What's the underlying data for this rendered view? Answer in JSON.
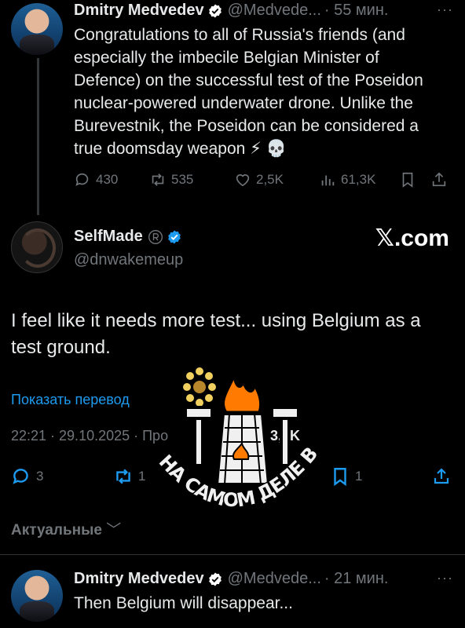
{
  "tweet1": {
    "author": "Dmitry Medvedev",
    "handle": "@Medvede...",
    "time": "· 55 мин.",
    "more": "···",
    "lines": [
      "Congratulations to all of Russia's friends (and",
      "especially the imbecile Belgian Minister of",
      "Defence) on the successful test of the Poseidon",
      "nuclear-powered underwater drone. Unlike the",
      "Burevestnik, the Poseidon can be considered a",
      "true doomsday weapon ⚡ 💀"
    ],
    "replies": "430",
    "reposts": "535",
    "likes": "2,5K",
    "views": "61,3K"
  },
  "tweet2": {
    "author": "SelfMade",
    "handle": "@dnwakemeup",
    "site": "𝕏.com",
    "lines": [
      "I feel like it needs more test... using Belgium as a",
      "test ground."
    ],
    "translate": "Показать перевод",
    "datetime": "22:21 · 29.10.2025 · Про",
    "views": "3,4K",
    "replies": "3",
    "reposts": "1",
    "bookmarks": "1",
    "sort_label": "Актуальные"
  },
  "tweet3": {
    "author": "Dmitry Medvedev",
    "handle": "@Medvede...",
    "time": "· 21 мин.",
    "more": "···",
    "text": "Then Belgium will disappear..."
  },
  "emblem": {
    "slogan": "НА САМОМ ДЕЛЕ В ЛУГАНСКЕ",
    "colors": {
      "flame": "#ff7a00",
      "ink": "#000000",
      "paper": "#f0f0f0",
      "gold": "#f2d060"
    }
  },
  "colors": {
    "background": "#000000",
    "accent": "#1d9bf0",
    "muted": "#71767b",
    "text": "#e7e9ea"
  }
}
